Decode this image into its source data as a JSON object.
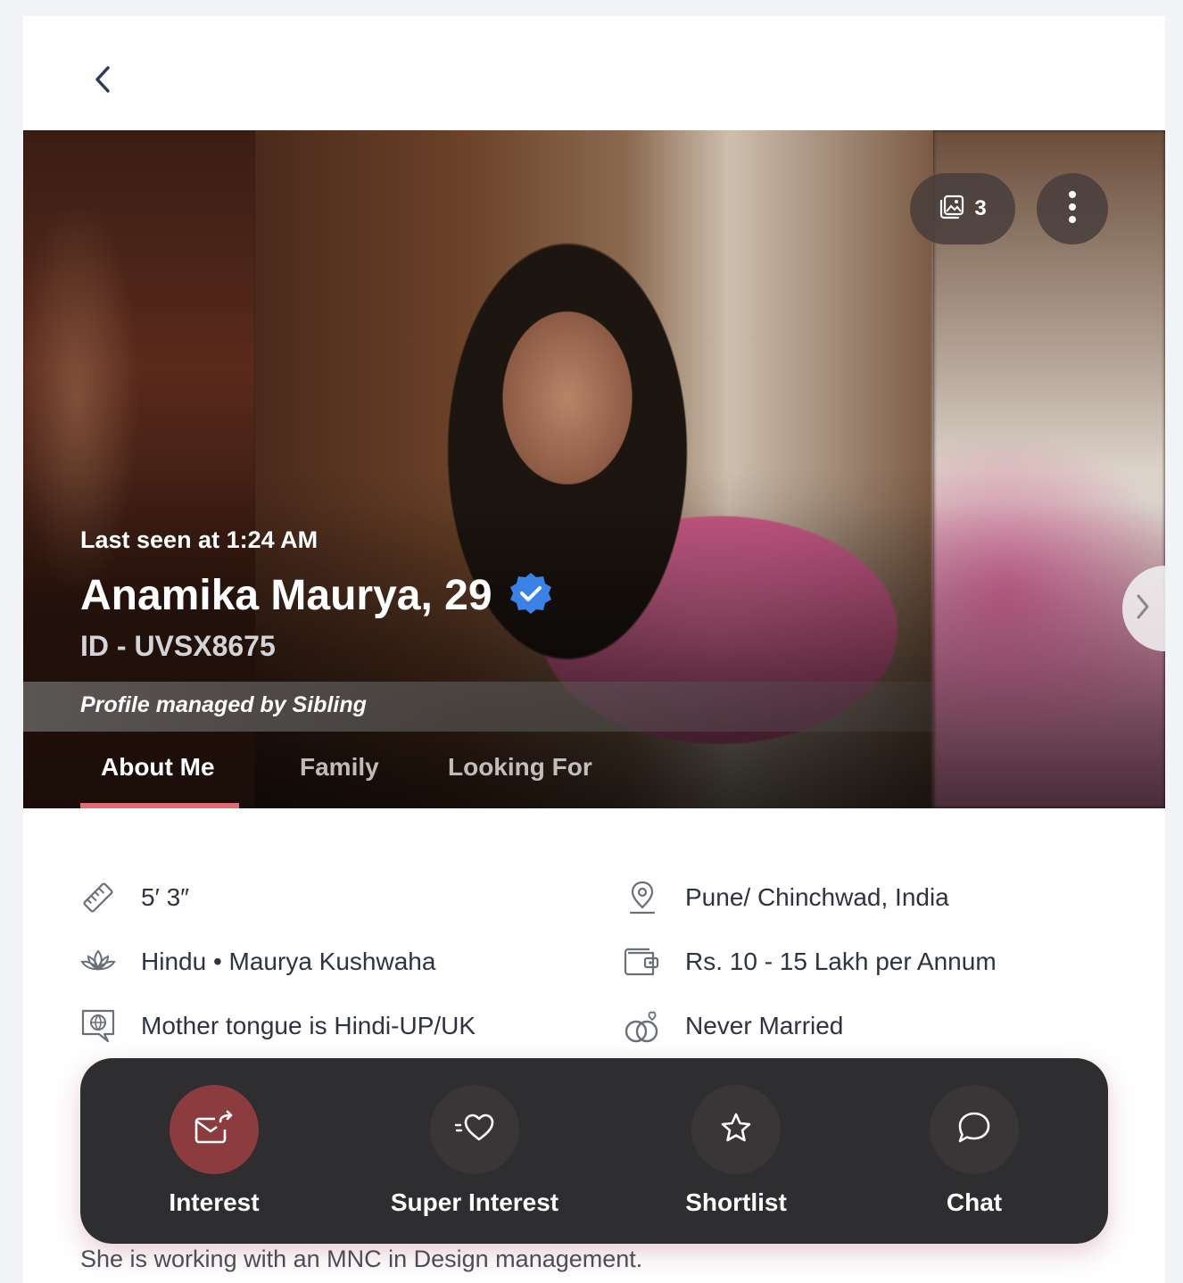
{
  "profile": {
    "last_seen": "Last seen at 1:24 AM",
    "name": "Anamika Maurya, 29",
    "id": "ID - UVSX8675",
    "managed_by": "Profile managed by Sibling",
    "photo_count": "3"
  },
  "tabs": [
    {
      "label": "About Me",
      "active": true
    },
    {
      "label": "Family",
      "active": false
    },
    {
      "label": "Looking For",
      "active": false
    }
  ],
  "details": {
    "height": "5′ 3″",
    "religion": "Hindu • Maurya Kushwaha",
    "mother_tongue": "Mother tongue is Hindi-UP/UK",
    "location": "Pune/ Chinchwad, India",
    "income": "Rs. 10 - 15 Lakh per Annum",
    "marital_status": "Never Married"
  },
  "about": {
    "visible_line": "She is working with an MNC in Design management."
  },
  "actions": {
    "interest": "Interest",
    "super_interest": "Super Interest",
    "shortlist": "Shortlist",
    "chat": "Chat"
  },
  "colors": {
    "accent": "#e06a72",
    "interest_circle": "#8c3b3f",
    "verified": "#3b82e6",
    "action_bar": "#1e1e20"
  },
  "icons": {
    "back": "chevron-left-icon",
    "gallery": "image-gallery-icon",
    "more": "kebab-menu-icon",
    "next": "chevron-right-icon",
    "verified": "verified-badge-icon",
    "height": "ruler-icon",
    "religion": "lotus-icon",
    "language": "language-icon",
    "location": "location-pin-icon",
    "income": "wallet-icon",
    "marital": "rings-icon",
    "interest": "send-mail-icon",
    "super_interest": "heart-icon",
    "shortlist": "star-icon",
    "chat": "chat-bubble-icon"
  }
}
